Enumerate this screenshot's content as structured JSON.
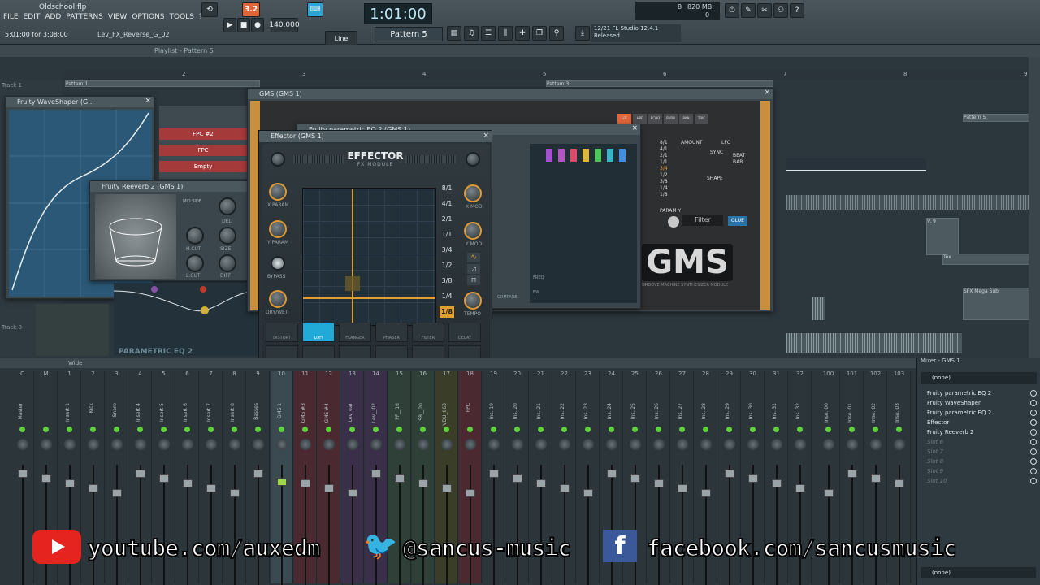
{
  "app": {
    "file_title": "Oldschool.flp",
    "hint_time": "5:01:00 for 3:08:00",
    "hint_pattern": "Lev_FX_Reverse_G_02",
    "menu": [
      "FILE",
      "EDIT",
      "ADD",
      "PATTERNS",
      "VIEW",
      "OPTIONS",
      "TOOLS",
      "?"
    ]
  },
  "transport": {
    "bpm": "140.000",
    "time": "1:01:00",
    "pattern": "Pattern 5",
    "snap": "Line",
    "rec_badge": "3.2",
    "cpu_value": "8",
    "memory": "820 MB",
    "memory_sub": "0",
    "hint_panel_line1": "12/21  FL Studio 12.4.1",
    "hint_panel_line2": "Released"
  },
  "playlist": {
    "title": "Playlist - Pattern 5",
    "ruler": [
      "2",
      "3",
      "4",
      "5",
      "6",
      "7",
      "8",
      "9"
    ],
    "track1": "Track 1",
    "track8": "Track 8",
    "clips": [
      "Pattern 1",
      "Pattern 3",
      "Pattern 5",
      "V. 9",
      "Tex",
      "SFX Mega Sub"
    ]
  },
  "windows": {
    "waveshaper": "Fruity WaveShaper (G...",
    "reeverb": "Fruity Reeverb 2 (GMS 1)",
    "reeverb_labels": [
      "MID SIDE",
      "DEL",
      "H.CUT",
      "SIZE",
      "L.CUT",
      "DIFF"
    ],
    "parametric": "PARAMETRIC EQ 2",
    "fpc_items": [
      "FPC #2",
      "FPC",
      "Empty"
    ],
    "gms": "GMS (GMS 1)",
    "peq_small": "Fruity parametric EQ 2 (GMS 1)",
    "gms_labels": [
      "AMOUNT",
      "LFO",
      "SYNC",
      "BEAT",
      "BAR",
      "SHAPE",
      "PARAM Y",
      "Filter",
      "GLUE"
    ],
    "gms_rates": [
      "8/1",
      "4/1",
      "2/1",
      "1/1",
      "3/4",
      "1/2",
      "3/8",
      "1/4",
      "1/8"
    ],
    "gms_tabs": [
      "LPF",
      "HPF",
      "ECHO",
      "RVRB",
      "PAN",
      "TRIC"
    ],
    "gms_logo": "GMS",
    "gms_sub": "GROOVE MACHINE SYNTHESIZER MODULE",
    "gms_freq": "FREQ",
    "gms_bw": "BW",
    "gms_compare": "COMPARE"
  },
  "effector": {
    "title": "Effector (GMS 1)",
    "logo": "EFFECTOR",
    "sub": "FX MODULE",
    "gain": "GAIN",
    "xparam": "X PARAM",
    "yparam": "Y PARAM",
    "bypass": "BYPASS",
    "drywet": "DRY/WET",
    "xmod": "X MOD",
    "ymod": "Y MOD",
    "tempo": "TEMPO",
    "rates": [
      "8/1",
      "4/1",
      "2/1",
      "1/1",
      "3/4",
      "1/2",
      "3/8",
      "1/4",
      "1/8"
    ],
    "active_rate": "1/8",
    "fx_top": [
      "DISTORT",
      "LOFI",
      "FLANGER",
      "PHASER",
      "FILTER",
      "DELAY"
    ],
    "fx_bottom": [
      "REVERB",
      "STEREO",
      "TRANS",
      "GRAIN",
      "VOX",
      "RING"
    ],
    "active_fx": "LOFI"
  },
  "mixer": {
    "title": "Wide",
    "panel_title": "Mixer - GMS 1",
    "channels": [
      {
        "n": "C",
        "name": "Master"
      },
      {
        "n": "M",
        "name": ""
      },
      {
        "n": "1",
        "name": "Insert 1"
      },
      {
        "n": "2",
        "name": "Kick"
      },
      {
        "n": "3",
        "name": "Snare"
      },
      {
        "n": "4",
        "name": "Insert 4"
      },
      {
        "n": "5",
        "name": "Insert 5"
      },
      {
        "n": "6",
        "name": "Insert 6"
      },
      {
        "n": "7",
        "name": "Insert 7"
      },
      {
        "n": "8",
        "name": "Insert 8"
      },
      {
        "n": "9",
        "name": "Basses"
      },
      {
        "n": "10",
        "name": "GMS 1"
      },
      {
        "n": "11",
        "name": "GMS #3"
      },
      {
        "n": "12",
        "name": "GMS #4"
      },
      {
        "n": "13",
        "name": "Lev_ear"
      },
      {
        "n": "14",
        "name": "Lev__02"
      },
      {
        "n": "15",
        "name": "PF__16"
      },
      {
        "n": "16",
        "name": "SR__20"
      },
      {
        "n": "17",
        "name": "VDU_063"
      },
      {
        "n": "18",
        "name": "FPC"
      },
      {
        "n": "19",
        "name": "Ins. 19"
      },
      {
        "n": "20",
        "name": "Ins. 20"
      },
      {
        "n": "21",
        "name": "Ins. 21"
      },
      {
        "n": "22",
        "name": "Ins. 22"
      },
      {
        "n": "23",
        "name": "Ins. 23"
      },
      {
        "n": "24",
        "name": "Ins. 24"
      },
      {
        "n": "25",
        "name": "Ins. 25"
      },
      {
        "n": "26",
        "name": "Ins. 26"
      },
      {
        "n": "27",
        "name": "Ins. 27"
      },
      {
        "n": "28",
        "name": "Ins. 28"
      },
      {
        "n": "29",
        "name": "Ins. 29"
      },
      {
        "n": "30",
        "name": "Ins. 30"
      },
      {
        "n": "31",
        "name": "Ins. 31"
      },
      {
        "n": "32",
        "name": "Ins. 32"
      },
      {
        "n": "100",
        "name": "Inse. 00"
      },
      {
        "n": "101",
        "name": "Inse. 01"
      },
      {
        "n": "102",
        "name": "Inse. 02"
      },
      {
        "n": "103",
        "name": "Inse. 03"
      }
    ],
    "input_select": "(none)",
    "output_select": "(none)",
    "slots": [
      {
        "label": "Fruity parametric EQ 2",
        "empty": false
      },
      {
        "label": "Fruity WaveShaper",
        "empty": false
      },
      {
        "label": "Fruity parametric EQ 2",
        "empty": false
      },
      {
        "label": "Effector",
        "empty": false
      },
      {
        "label": "Fruity Reeverb 2",
        "empty": false
      },
      {
        "label": "Slot 6",
        "empty": true
      },
      {
        "label": "Slot 7",
        "empty": true
      },
      {
        "label": "Slot 8",
        "empty": true
      },
      {
        "label": "Slot 9",
        "empty": true
      },
      {
        "label": "Slot 10",
        "empty": true
      }
    ]
  },
  "overlay": {
    "youtube": "youtube.com/auxedm",
    "twitter": "@sancus-music",
    "facebook": "facebook.com/sancusmusic"
  },
  "colors": {
    "accent": "#e0a030",
    "lofi": "#21a9d8",
    "youtube": "#e52420",
    "twitter": "#1da1f2",
    "facebook": "#3b5998"
  }
}
